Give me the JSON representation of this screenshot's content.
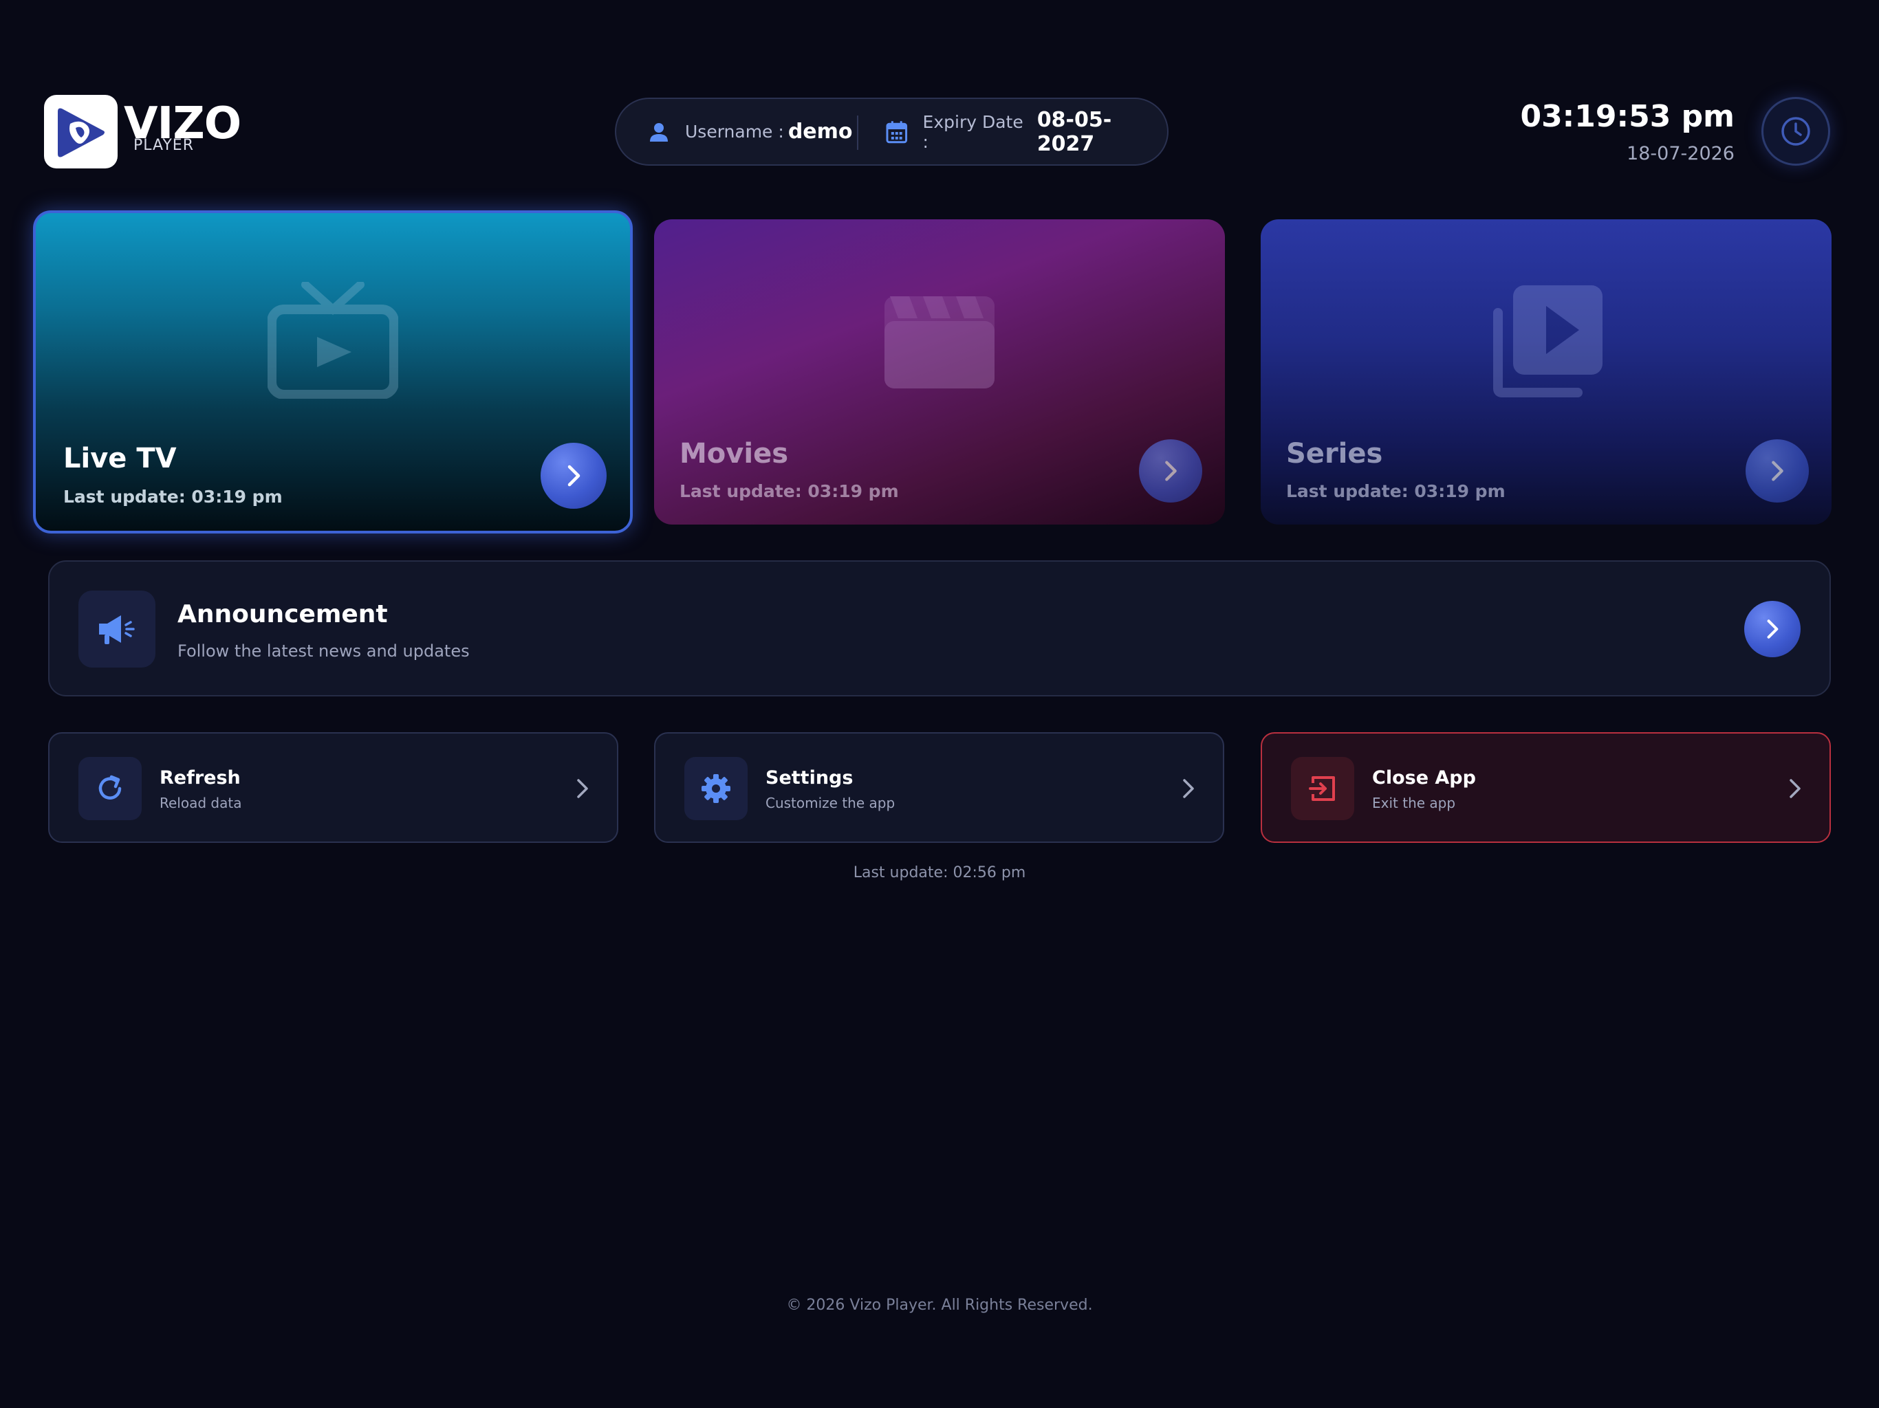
{
  "logo": {
    "brand": "VIZO",
    "sub": "PLAYER"
  },
  "header": {
    "username_label": "Username :",
    "username_value": "demo",
    "expiry_label": "Expiry Date :",
    "expiry_value": "08-05-2027"
  },
  "clock": {
    "time": "03:19:53 pm",
    "date": "18-07-2026"
  },
  "cards": [
    {
      "title": "Live TV",
      "sub": "Last update: 03:19 pm",
      "icon": "tv-icon"
    },
    {
      "title": "Movies",
      "sub": "Last update: 03:19 pm",
      "icon": "clapperboard-icon"
    },
    {
      "title": "Series",
      "sub": "Last update: 03:19 pm",
      "icon": "play-stack-icon"
    }
  ],
  "announcement": {
    "title": "Announcement",
    "sub": "Follow the latest news and updates"
  },
  "actions": [
    {
      "title": "Refresh",
      "sub": "Reload data"
    },
    {
      "title": "Settings",
      "sub": "Customize the app"
    },
    {
      "title": "Close App",
      "sub": "Exit the app"
    }
  ],
  "last_update": "Last update: 02:56 pm",
  "footer": "© 2026 Vizo Player. All Rights Reserved.",
  "colors": {
    "background": "#080916",
    "accent": "#3d63d6",
    "danger": "#b9303f",
    "icon_blue": "#5b8ef5",
    "icon_red": "#e0404e"
  }
}
